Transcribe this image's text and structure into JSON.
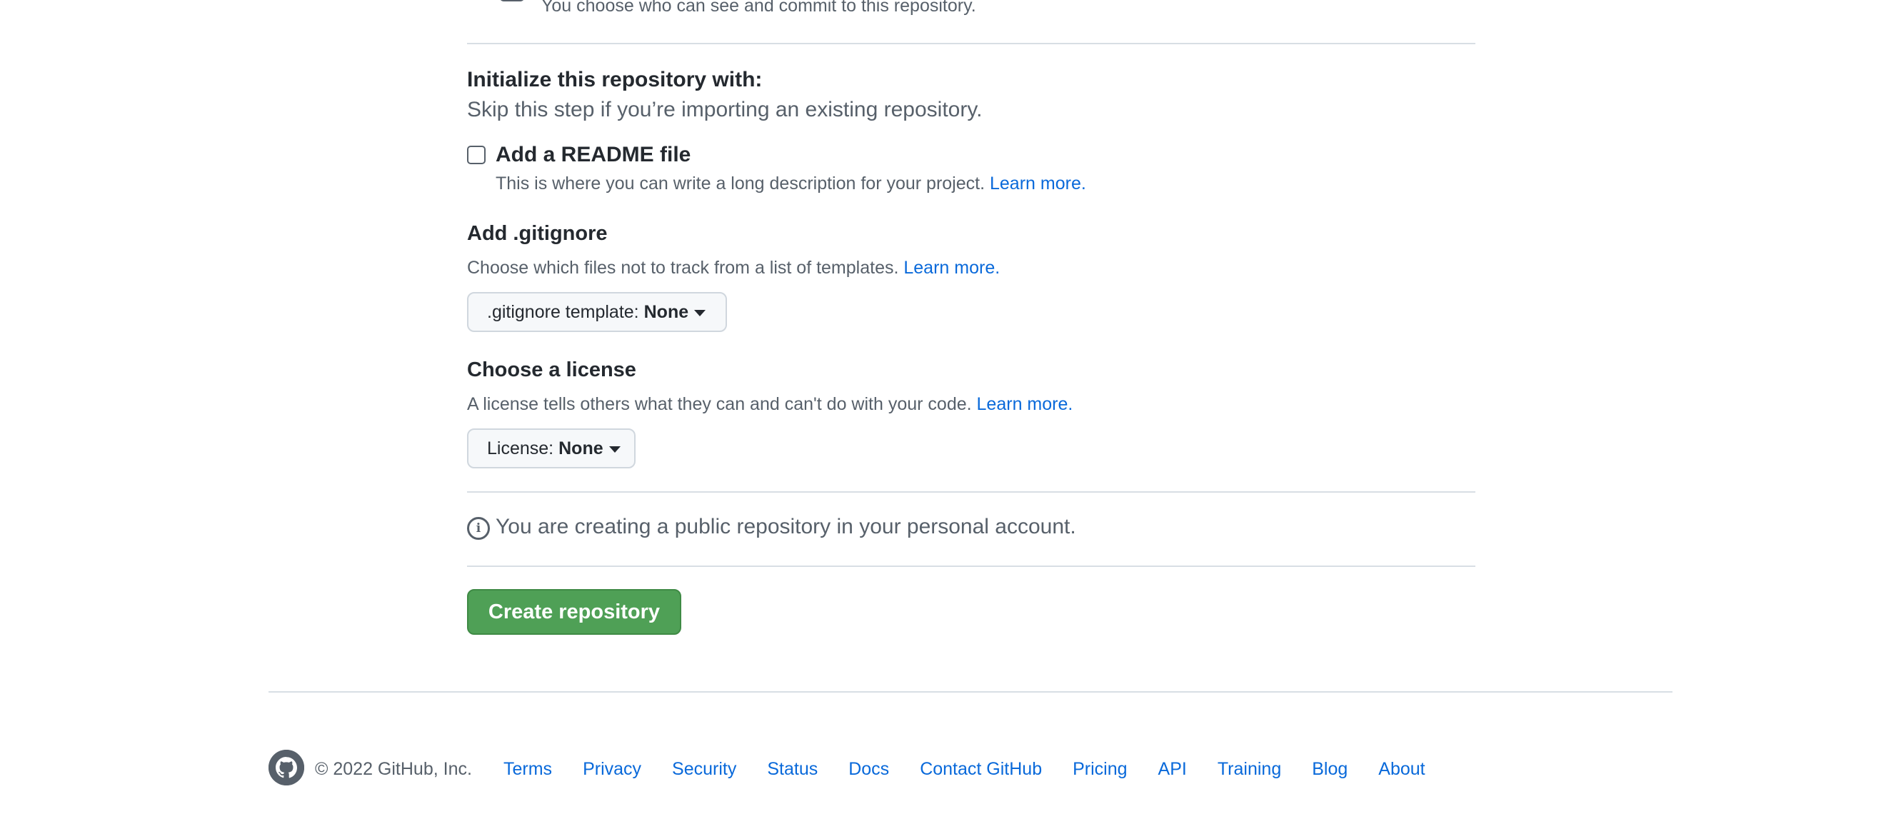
{
  "visibility": {
    "private_description": "You choose who can see and commit to this repository."
  },
  "initialize": {
    "title": "Initialize this repository with:",
    "subtitle": "Skip this step if you’re importing an existing repository.",
    "readme": {
      "label": "Add a README file",
      "checked": false,
      "description": "This is where you can write a long description for your project.",
      "learn_more": "Learn more."
    }
  },
  "gitignore": {
    "title": "Add .gitignore",
    "description": "Choose which files not to track from a list of templates.",
    "learn_more": "Learn more.",
    "select_key": ".gitignore template:",
    "select_value": "None"
  },
  "license": {
    "title": "Choose a license",
    "description": "A license tells others what they can and can't do with your code.",
    "learn_more": "Learn more.",
    "select_key": "License:",
    "select_value": "None"
  },
  "notice": {
    "text": "You are creating a public repository in your personal account."
  },
  "create_button": {
    "label": "Create repository"
  },
  "footer": {
    "copyright": "© 2022 GitHub, Inc.",
    "links": [
      "Terms",
      "Privacy",
      "Security",
      "Status",
      "Docs",
      "Contact GitHub",
      "Pricing",
      "API",
      "Training",
      "Blog",
      "About"
    ]
  },
  "colors": {
    "link": "#0969da",
    "primary_button": "#4fa056",
    "muted_text": "#57606a",
    "divider": "#d8dee4"
  }
}
